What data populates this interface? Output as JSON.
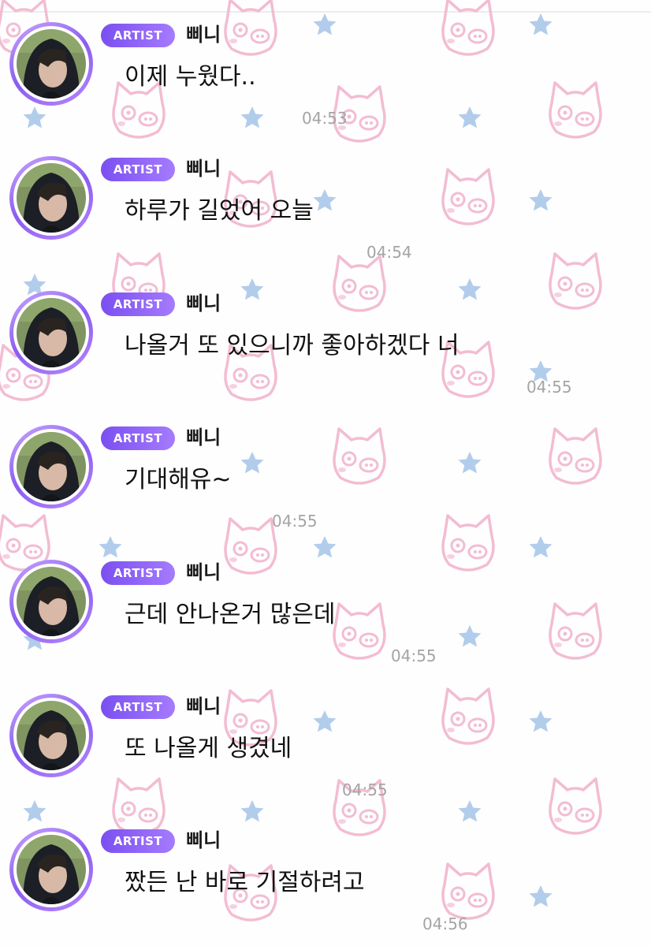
{
  "chat": {
    "messages": [
      {
        "badge": "ARTIST",
        "sender": "삐니",
        "text": "이제 누웠다..",
        "time": "04:53"
      },
      {
        "badge": "ARTIST",
        "sender": "삐니",
        "text": "하루가 길었어 오늘",
        "time": "04:54"
      },
      {
        "badge": "ARTIST",
        "sender": "삐니",
        "text": "나올거 또 있으니까 좋아하겠다 너",
        "time": "04:55"
      },
      {
        "badge": "ARTIST",
        "sender": "삐니",
        "text": "기대해유~",
        "time": "04:55"
      },
      {
        "badge": "ARTIST",
        "sender": "삐니",
        "text": "근데 안나온거 많은데",
        "time": "04:55"
      },
      {
        "badge": "ARTIST",
        "sender": "삐니",
        "text": "또 나올게 생겼네",
        "time": "04:55"
      },
      {
        "badge": "ARTIST",
        "sender": "삐니",
        "text": "짰든 난 바로 기절하려고",
        "time": "04:56"
      }
    ]
  },
  "theme": {
    "badge_color": "#8a5cf0",
    "avatar_ring_color": "#a57bff",
    "wallpaper_cat_color": "#f3b8d0",
    "wallpaper_star_color": "#a9c9ea"
  },
  "icons": {
    "wallpaper_motif": [
      "cat-face-icon",
      "star-icon"
    ]
  }
}
